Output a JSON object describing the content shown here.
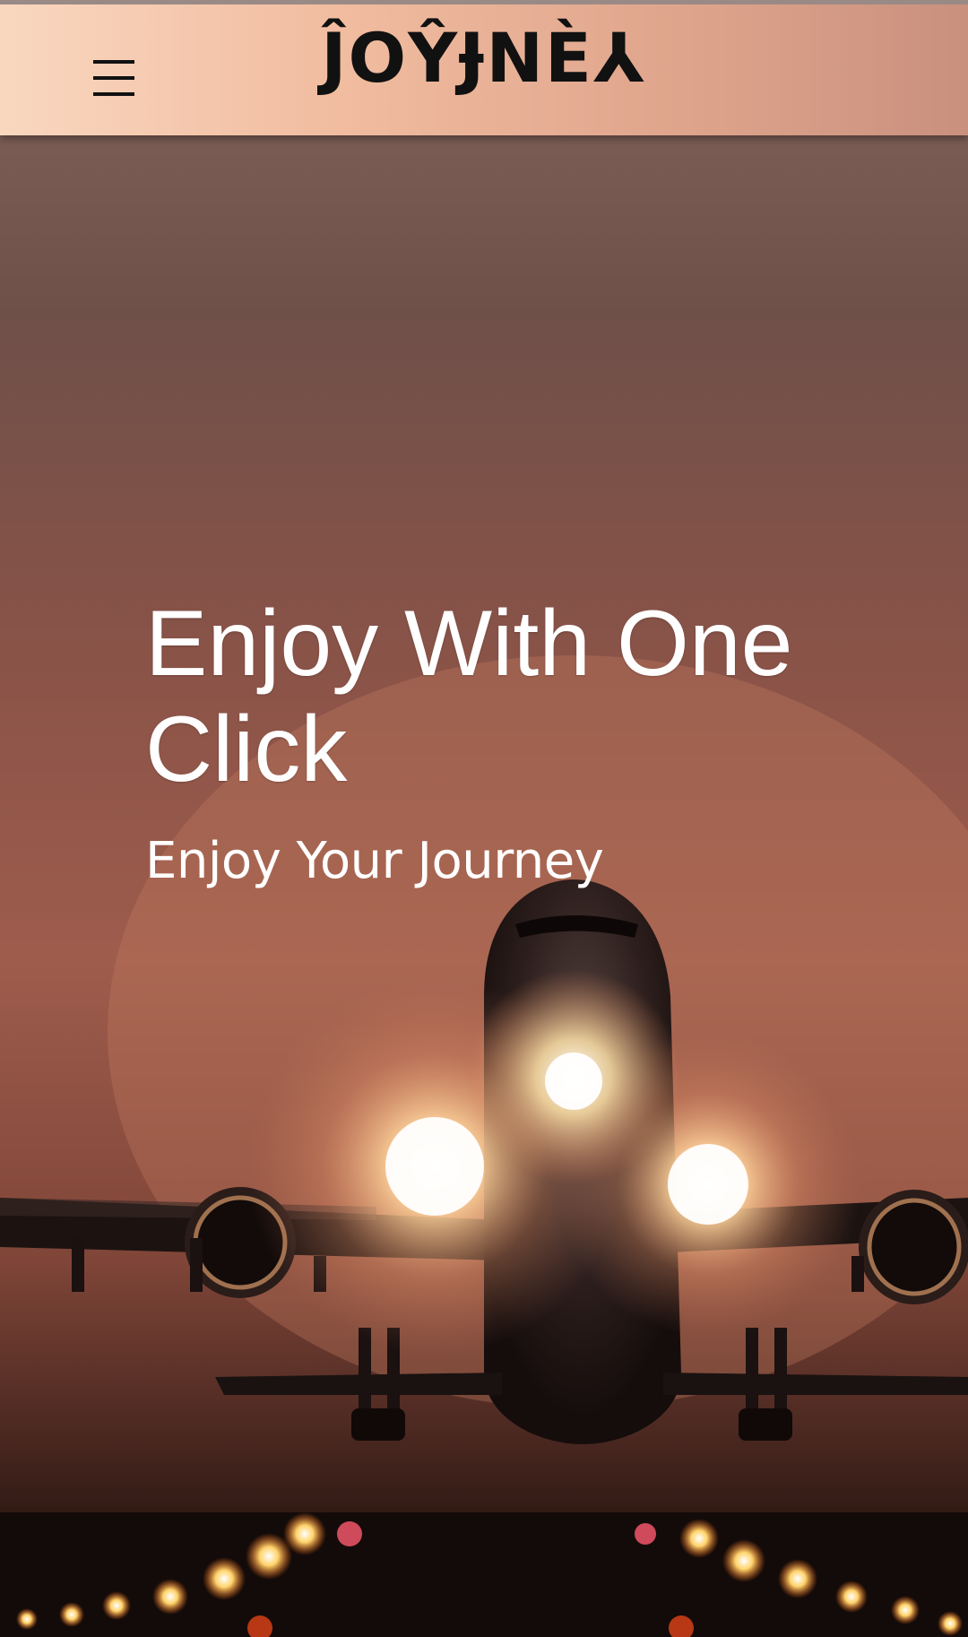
{
  "header": {
    "brand": "ĴOŶɈNÈ⅄",
    "menu_icon": "hamburger-menu-icon",
    "background_colors": [
      "#f9d7bf",
      "#c9907e"
    ]
  },
  "hero": {
    "title": "Enjoy With One Click",
    "subtitle": "Enjoy Your Journey",
    "image_subject": "airplane-taking-off-at-sunset",
    "tint_color": "#8a5045"
  }
}
